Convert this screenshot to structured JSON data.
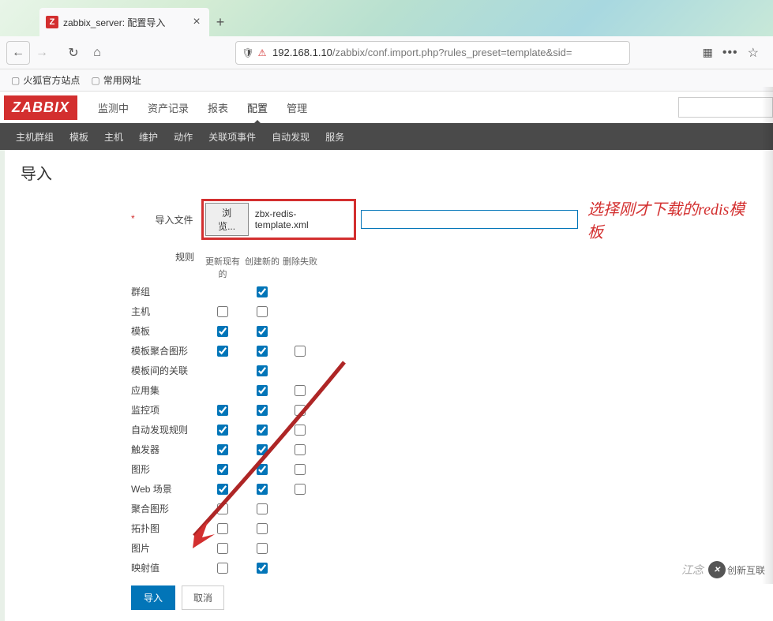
{
  "browser": {
    "tab_title": "zabbix_server: 配置导入",
    "favicon_letter": "Z",
    "url_host": "192.168.1.10",
    "url_path": "/zabbix/conf.import.php?rules_preset=template&sid=",
    "bookmarks": [
      "火狐官方站点",
      "常用网址"
    ]
  },
  "nav": {
    "logo": "ZABBIX",
    "items": [
      "监测中",
      "资产记录",
      "报表",
      "配置",
      "管理"
    ],
    "active_index": 3
  },
  "subnav": [
    "主机群组",
    "模板",
    "主机",
    "维护",
    "动作",
    "关联项事件",
    "自动发现",
    "服务"
  ],
  "page": {
    "title": "导入",
    "file_label": "导入文件",
    "browse_label": "浏览...",
    "file_name": "zbx-redis-template.xml",
    "callout": "选择刚才下载的redis模板",
    "rules_label": "规则",
    "cols": {
      "update": "更新现有的",
      "create": "创建新的",
      "delete": "删除失败"
    },
    "rules": [
      {
        "name": "群组",
        "u": null,
        "c": true,
        "d": null
      },
      {
        "name": "主机",
        "u": false,
        "c": false,
        "d": null
      },
      {
        "name": "模板",
        "u": true,
        "c": true,
        "d": null
      },
      {
        "name": "模板聚合图形",
        "u": true,
        "c": true,
        "d": false
      },
      {
        "name": "模板间的关联",
        "u": null,
        "c": true,
        "d": null
      },
      {
        "name": "应用集",
        "u": null,
        "c": true,
        "d": false
      },
      {
        "name": "监控项",
        "u": true,
        "c": true,
        "d": false
      },
      {
        "name": "自动发现规则",
        "u": true,
        "c": true,
        "d": false
      },
      {
        "name": "触发器",
        "u": true,
        "c": true,
        "d": false
      },
      {
        "name": "图形",
        "u": true,
        "c": true,
        "d": false
      },
      {
        "name": "Web 场景",
        "u": true,
        "c": true,
        "d": false
      },
      {
        "name": "聚合图形",
        "u": false,
        "c": false,
        "d": null
      },
      {
        "name": "拓扑图",
        "u": false,
        "c": false,
        "d": null
      },
      {
        "name": "图片",
        "u": false,
        "c": false,
        "d": null
      },
      {
        "name": "映射值",
        "u": false,
        "c": true,
        "d": null
      }
    ],
    "btn_submit": "导入",
    "btn_cancel": "取消"
  },
  "watermark": {
    "text1": "江念",
    "text2": "创新互联"
  }
}
